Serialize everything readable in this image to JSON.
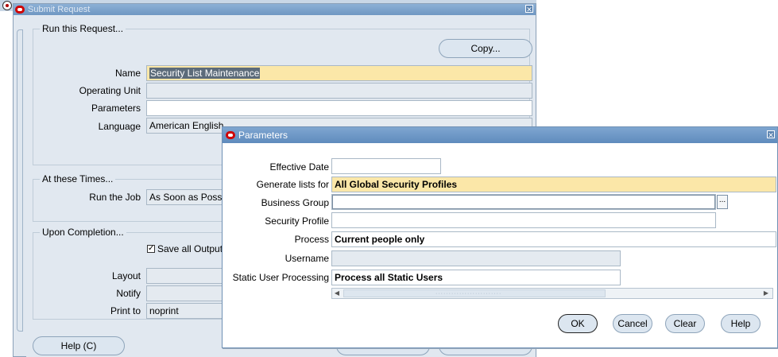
{
  "submit_request": {
    "title": "Submit Request",
    "run_group": {
      "label": "Run this Request...",
      "copy_button": "Copy...",
      "name_label": "Name",
      "name_value": "Security List Maintenance",
      "operating_unit_label": "Operating Unit",
      "operating_unit_value": "",
      "parameters_label": "Parameters",
      "parameters_value": "",
      "language_label": "Language",
      "language_value": "American English"
    },
    "times_group": {
      "label": "At these Times...",
      "run_job_label": "Run the Job",
      "run_job_value": "As Soon as Possible"
    },
    "completion_group": {
      "label": "Upon Completion...",
      "save_output_label": "Save all Output File",
      "save_output_checked": true,
      "layout_label": "Layout",
      "layout_value": "",
      "notify_label": "Notify",
      "notify_value": "",
      "print_to_label": "Print to",
      "print_to_value": "noprint"
    },
    "help_button": "Help (C)"
  },
  "parameters": {
    "title": "Parameters",
    "effective_date_label": "Effective Date",
    "effective_date_value": "",
    "generate_lists_label": "Generate lists for",
    "generate_lists_value": "All Global Security Profiles",
    "business_group_label": "Business Group",
    "business_group_value": "",
    "lov_label": "...",
    "security_profile_label": "Security Profile",
    "security_profile_value": "",
    "process_label": "Process",
    "process_value": "Current people only",
    "username_label": "Username",
    "username_value": "",
    "static_user_label": "Static User Processing",
    "static_user_value": "Process all Static Users",
    "buttons": {
      "ok": "OK",
      "cancel": "Cancel",
      "clear": "Clear",
      "help": "Help"
    }
  },
  "colors": {
    "required_field": "#fbe7a8",
    "window_bg": "#e1e8f0",
    "titlebar": "#6f97c2"
  },
  "icons": {
    "app_icon": "oracle-forms-icon",
    "window_logo": "oracle-logo-icon",
    "close": "close-icon"
  }
}
